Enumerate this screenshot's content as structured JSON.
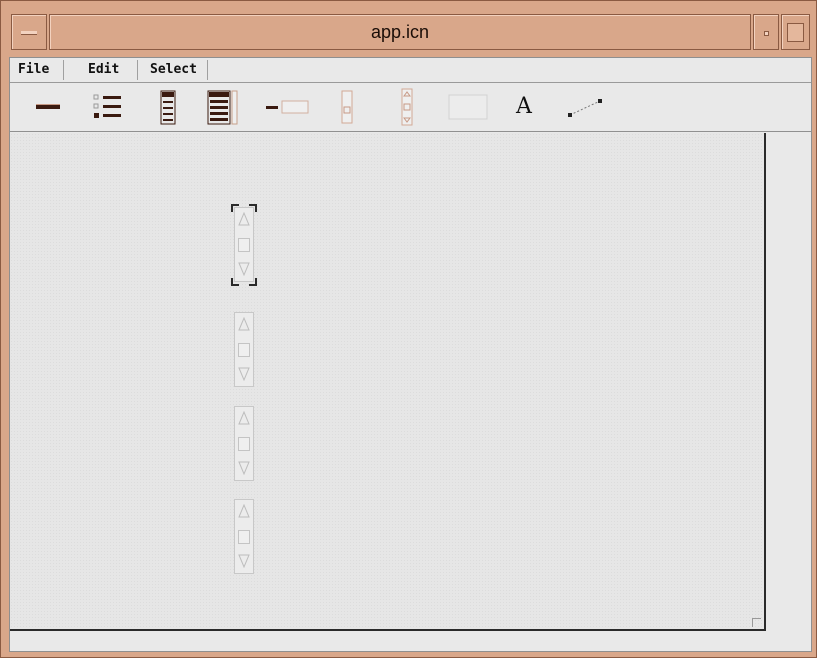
{
  "window": {
    "title": "app.icn"
  },
  "menubar": {
    "items": [
      {
        "label": "File"
      },
      {
        "label": "Edit"
      },
      {
        "label": "Select"
      }
    ]
  },
  "toolbar": {
    "tools": [
      {
        "icon": "horizontal-rule-icon"
      },
      {
        "icon": "checklist-icon"
      },
      {
        "icon": "list-box-icon"
      },
      {
        "icon": "list-box-scrollbar-icon"
      },
      {
        "icon": "text-field-icon"
      },
      {
        "icon": "vertical-slider-icon"
      },
      {
        "icon": "vertical-scrollbar-icon"
      },
      {
        "icon": "rectangle-icon"
      },
      {
        "label": "A",
        "icon": "text-label-icon"
      },
      {
        "icon": "line-icon"
      }
    ]
  },
  "canvas": {
    "widgets": [
      {
        "type": "vertical-scrollbar",
        "selected": true
      },
      {
        "type": "vertical-scrollbar",
        "selected": false
      },
      {
        "type": "vertical-scrollbar",
        "selected": false
      },
      {
        "type": "vertical-scrollbar",
        "selected": false
      }
    ]
  },
  "colors": {
    "frame": "#d9a78a",
    "client": "#e9e9e9",
    "canvas": "#e6e6e6"
  }
}
